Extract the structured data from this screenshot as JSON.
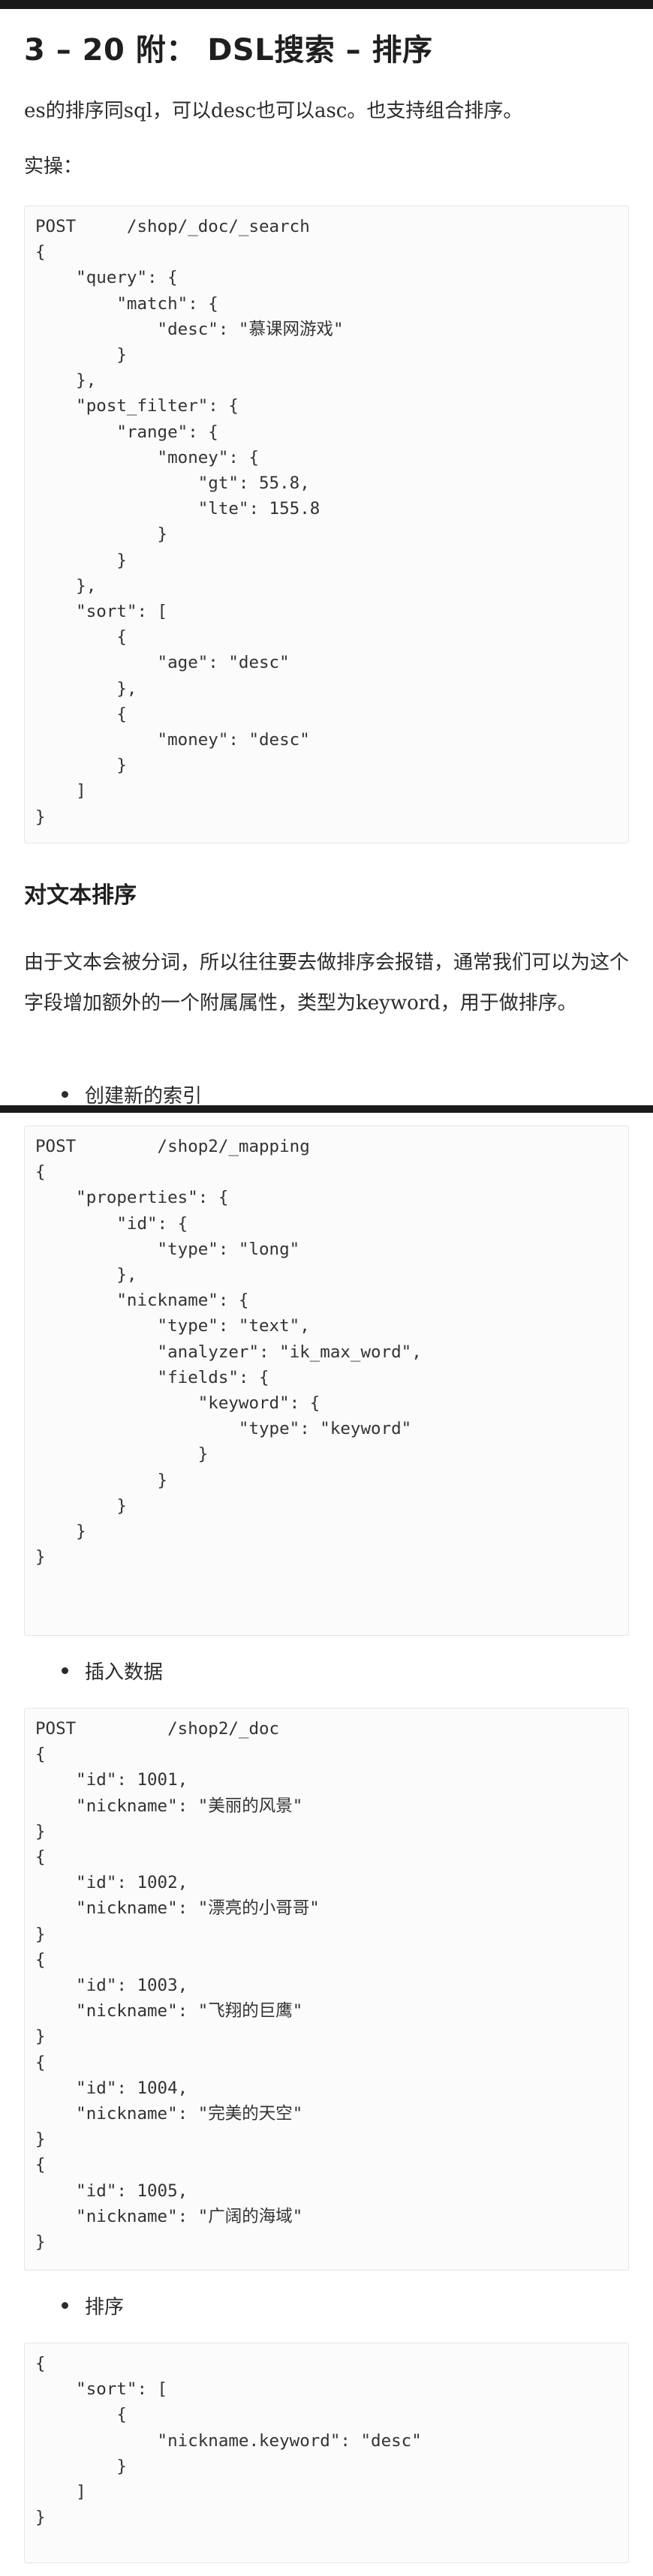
{
  "heading": "3 – 20 附： DSL搜索 – 排序",
  "intro": "es的排序同sql，可以desc也可以asc。也支持组合排序。",
  "practice_label": "实操：",
  "code1": "POST     /shop/_doc/_search\n{\n    \"query\": {\n        \"match\": {\n            \"desc\": \"慕课网游戏\"\n        }\n    },\n    \"post_filter\": {\n        \"range\": {\n            \"money\": {\n                \"gt\": 55.8,\n                \"lte\": 155.8\n            }\n        }\n    },\n    \"sort\": [\n        {\n            \"age\": \"desc\"\n        },\n        {\n            \"money\": \"desc\"\n        }\n    ]\n}",
  "section_title": "对文本排序",
  "text_sort_para": "由于文本会被分词，所以往往要去做排序会报错，通常我们可以为这个字段增加额外的一个附属属性，类型为keyword，用于做排序。",
  "bullet_create_index": "创建新的索引",
  "code2": "POST        /shop2/_mapping\n{\n    \"properties\": {\n        \"id\": {\n            \"type\": \"long\"\n        },\n        \"nickname\": {\n            \"type\": \"text\",\n            \"analyzer\": \"ik_max_word\",\n            \"fields\": {\n                \"keyword\": {\n                    \"type\": \"keyword\"\n                }\n            }\n        }\n    }\n}",
  "bullet_insert": "插入数据",
  "code3": "POST         /shop2/_doc\n{\n    \"id\": 1001,\n    \"nickname\": \"美丽的风景\"\n}\n{\n    \"id\": 1002,\n    \"nickname\": \"漂亮的小哥哥\"\n}\n{\n    \"id\": 1003,\n    \"nickname\": \"飞翔的巨鹰\"\n}\n{\n    \"id\": 1004,\n    \"nickname\": \"完美的天空\"\n}\n{\n    \"id\": 1005,\n    \"nickname\": \"广阔的海域\"\n}",
  "bullet_sort": "排序",
  "code4": "{\n    \"sort\": [\n        {\n            \"nickname.keyword\": \"desc\"\n        }\n    ]\n}"
}
